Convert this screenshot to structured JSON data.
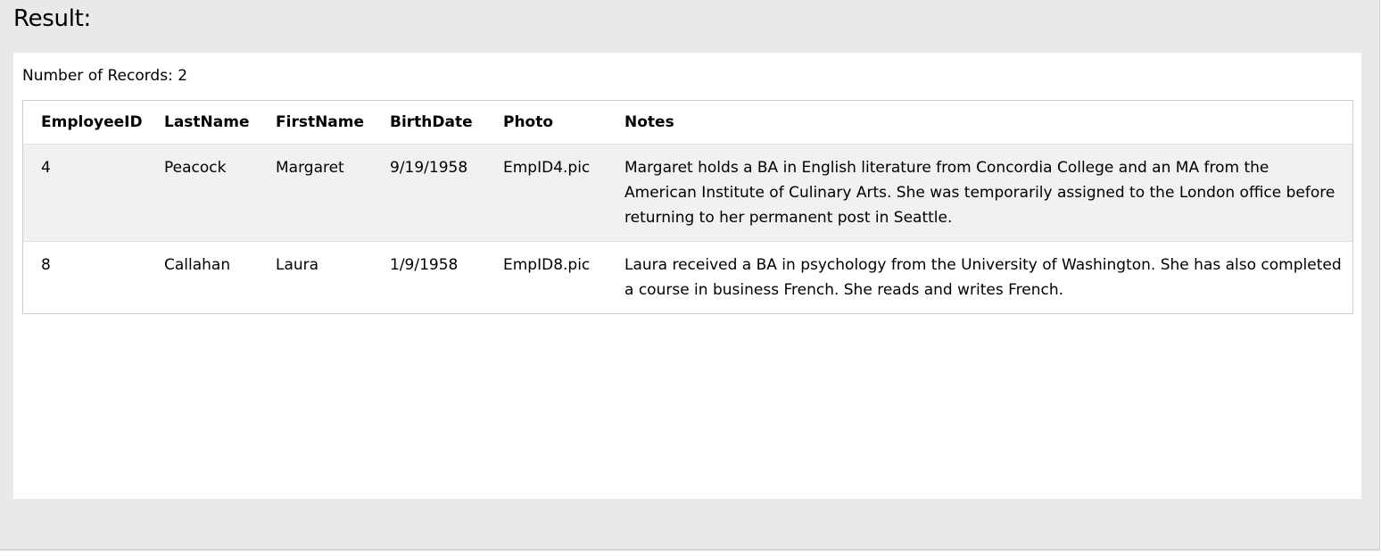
{
  "heading": "Result:",
  "record_count_label": "Number of Records: 2",
  "table": {
    "columns": [
      "EmployeeID",
      "LastName",
      "FirstName",
      "BirthDate",
      "Photo",
      "Notes"
    ],
    "rows": [
      {
        "EmployeeID": "4",
        "LastName": "Peacock",
        "FirstName": "Margaret",
        "BirthDate": "9/19/1958",
        "Photo": "EmpID4.pic",
        "Notes": "Margaret holds a BA in English literature from Concordia College and an MA from the American Institute of Culinary Arts. She was temporarily assigned to the London office before returning to her permanent post in Seattle."
      },
      {
        "EmployeeID": "8",
        "LastName": "Callahan",
        "FirstName": "Laura",
        "BirthDate": "1/9/1958",
        "Photo": "EmpID8.pic",
        "Notes": "Laura received a BA in psychology from the University of Washington. She has also completed a course in business French. She reads and writes French."
      }
    ]
  },
  "colors": {
    "frame_background": "#e7e9eb",
    "panel_background": "#ffffff",
    "striped_row": "#f1f1f1",
    "table_border": "#cccccc"
  }
}
